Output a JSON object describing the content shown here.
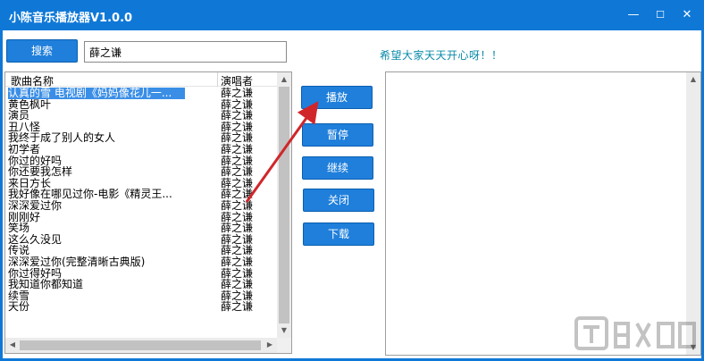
{
  "window": {
    "title": "小陈音乐播放器V1.0.0",
    "minimize": "—",
    "maximize": "☐",
    "close": "✕"
  },
  "search": {
    "button_label": "搜索",
    "input_value": "薛之谦"
  },
  "greeting": "希望大家天天开心呀！！",
  "list": {
    "header_song": "歌曲名称",
    "header_artist": "演唱者",
    "rows": [
      {
        "song": "认真的雪 电视剧《妈妈像花儿一...",
        "artist": "薛之谦",
        "selected": true
      },
      {
        "song": "黄色枫叶",
        "artist": "薛之谦"
      },
      {
        "song": "演员",
        "artist": "薛之谦"
      },
      {
        "song": "丑八怪",
        "artist": "薛之谦"
      },
      {
        "song": "我终于成了别人的女人",
        "artist": "薛之谦"
      },
      {
        "song": "初学者",
        "artist": "薛之谦"
      },
      {
        "song": "你过的好吗",
        "artist": "薛之谦"
      },
      {
        "song": "你还要我怎样",
        "artist": "薛之谦"
      },
      {
        "song": "来日方长",
        "artist": "薛之谦"
      },
      {
        "song": "我好像在哪见过你-电影《精灵王...",
        "artist": "薛之谦"
      },
      {
        "song": "深深爱过你",
        "artist": "薛之谦"
      },
      {
        "song": "刚刚好",
        "artist": "薛之谦"
      },
      {
        "song": "笑场",
        "artist": "薛之谦"
      },
      {
        "song": "这么久没见",
        "artist": "薛之谦"
      },
      {
        "song": "传说",
        "artist": "薛之谦"
      },
      {
        "song": "深深爱过你(完整清晰古典版)",
        "artist": "薛之谦"
      },
      {
        "song": "你过得好吗",
        "artist": "薛之谦"
      },
      {
        "song": "我知道你都知道",
        "artist": "薛之谦"
      },
      {
        "song": "续雪",
        "artist": "薛之谦"
      },
      {
        "song": "天份",
        "artist": "薛之谦"
      }
    ]
  },
  "controls": {
    "play": "播放",
    "pause": "暂停",
    "resume": "继续",
    "close": "关闭",
    "download": "下载"
  },
  "icons": {
    "arrow": "red-annotation-arrow",
    "watermark": "site-watermark-logo"
  },
  "colors": {
    "titlebar": "#0f78d7",
    "button": "#1f7fdb",
    "greeting": "#0a8aa8",
    "selection": "#3a8ee6",
    "arrow": "#d0262a"
  }
}
